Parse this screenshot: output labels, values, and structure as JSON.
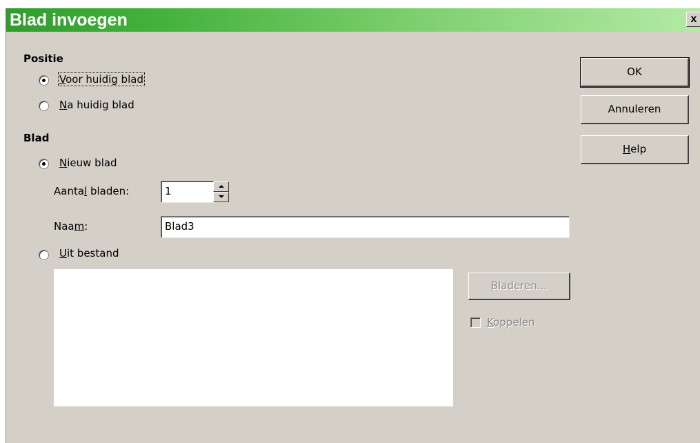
{
  "dialog": {
    "title": "Blad invoegen",
    "close": "x"
  },
  "position": {
    "heading": "Positie",
    "options": [
      {
        "pre": "",
        "accel": "V",
        "rest": "oor huidig blad",
        "checked": true
      },
      {
        "pre": "",
        "accel": "N",
        "rest": "a huidig blad",
        "checked": false
      }
    ]
  },
  "sheet": {
    "heading": "Blad",
    "new_sheet": {
      "accel": "N",
      "rest": "ieuw blad",
      "checked": true
    },
    "count_label": {
      "pre": "Aanta",
      "accel": "l",
      "rest": " bladen:"
    },
    "count_value": "1",
    "name_label": {
      "pre": "Naa",
      "accel": "m",
      "rest": ":"
    },
    "name_value": "Blad3",
    "from_file": {
      "accel": "U",
      "rest": "it bestand",
      "checked": false
    },
    "browse": {
      "accel": "B",
      "rest": "laderen..."
    },
    "link": {
      "accel": "K",
      "rest": "oppelen",
      "checked": false
    }
  },
  "buttons": {
    "ok": "OK",
    "cancel": "Annuleren",
    "help": {
      "accel": "H",
      "rest": "elp"
    }
  },
  "colors": {
    "title_gradient_start": "#2f9d2a",
    "title_gradient_end": "#b4eaa6",
    "dialog_bg": "#d4d0c8"
  }
}
